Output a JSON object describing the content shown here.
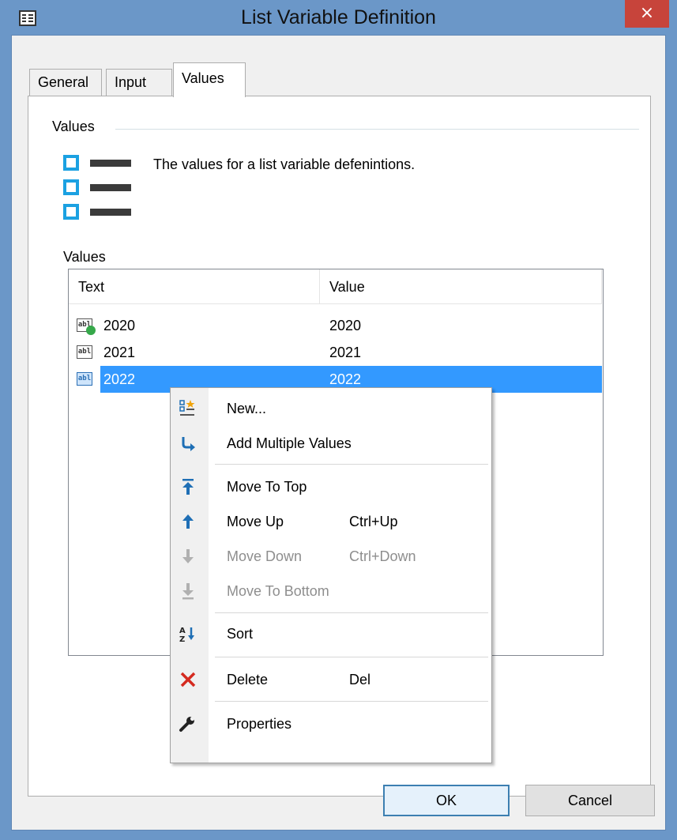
{
  "window": {
    "title": "List Variable Definition",
    "close_glyph": "×"
  },
  "tabs": [
    {
      "label": "General"
    },
    {
      "label": "Input"
    },
    {
      "label": "Values"
    }
  ],
  "group": {
    "label": "Values",
    "description": "The values for a list variable defenintions."
  },
  "list": {
    "label": "Values",
    "columns": [
      "Text",
      "Value"
    ],
    "rows": [
      {
        "text": "2020",
        "value": "2020",
        "icon": "text-default-icon"
      },
      {
        "text": "2021",
        "value": "2021",
        "icon": "text-icon"
      },
      {
        "text": "2022",
        "value": "2022",
        "icon": "text-icon",
        "selected": true
      }
    ],
    "row_icon_text": "abl"
  },
  "context_menu": {
    "items": [
      {
        "label": "New...",
        "shortcut": "",
        "icon": "new-item-icon",
        "enabled": true
      },
      {
        "label": "Add Multiple Values",
        "shortcut": "",
        "icon": "add-multiple-icon",
        "enabled": true
      },
      {
        "label": "Move To Top",
        "shortcut": "",
        "icon": "move-to-top-icon",
        "enabled": true
      },
      {
        "label": "Move Up",
        "shortcut": "Ctrl+Up",
        "icon": "move-up-icon",
        "enabled": true
      },
      {
        "label": "Move Down",
        "shortcut": "Ctrl+Down",
        "icon": "move-down-icon",
        "enabled": false
      },
      {
        "label": "Move To Bottom",
        "shortcut": "",
        "icon": "move-to-bottom-icon",
        "enabled": false
      },
      {
        "label": "Sort",
        "shortcut": "",
        "icon": "sort-az-icon",
        "enabled": true
      },
      {
        "label": "Delete",
        "shortcut": "Del",
        "icon": "delete-icon",
        "enabled": true
      },
      {
        "label": "Properties",
        "shortcut": "",
        "icon": "wrench-icon",
        "enabled": true
      }
    ]
  },
  "buttons": {
    "ok": "OK",
    "cancel": "Cancel"
  },
  "colors": {
    "frame": "#6b97c8",
    "close": "#c7443b",
    "selection": "#3399ff",
    "accent_icon": "#1ba1e2",
    "delete_icon": "#d42a1f"
  }
}
